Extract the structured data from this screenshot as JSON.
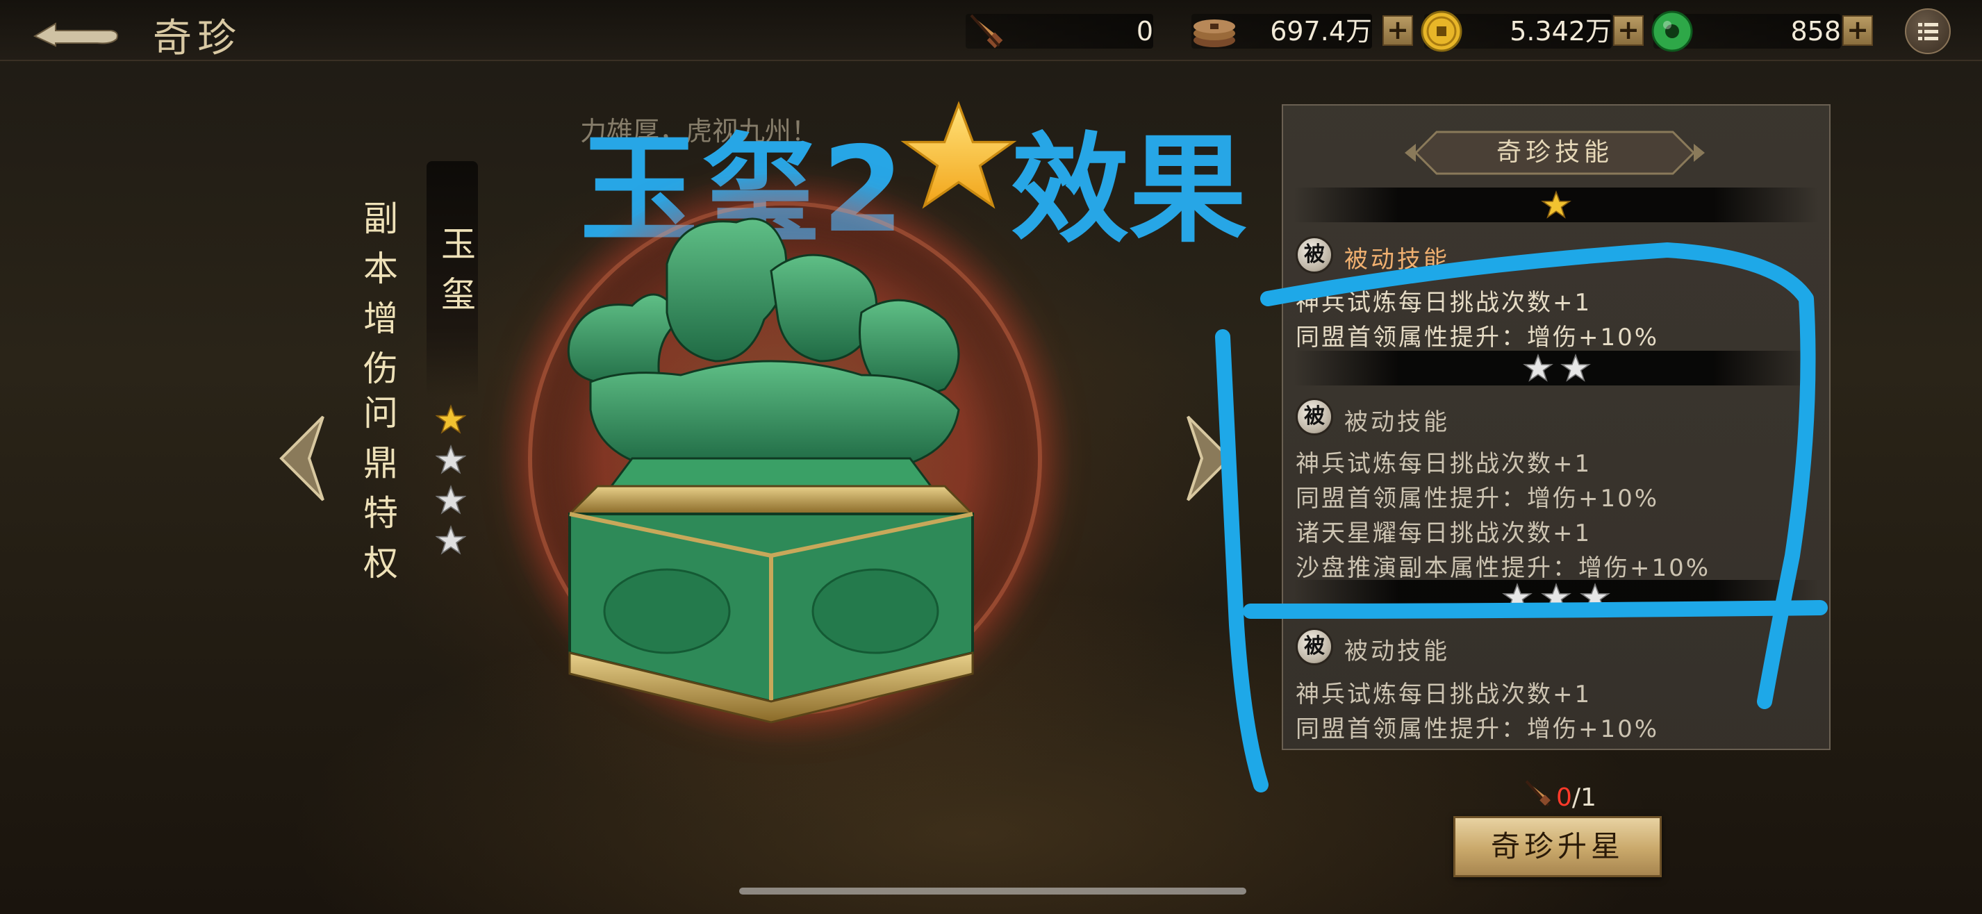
{
  "topbar": {
    "title": "奇珍",
    "resources": [
      {
        "icon": "token-icon",
        "value": "0"
      },
      {
        "icon": "coins-icon",
        "value": "697.4万"
      },
      {
        "icon": "gold-ingot-icon",
        "value": "5.342万"
      },
      {
        "icon": "jade-icon",
        "value": "858"
      }
    ],
    "plus_label": "+"
  },
  "annotation": {
    "headline_pre": "玉玺2",
    "headline_post": "效果",
    "flavor": "力雄厚，虎视九州！",
    "color": "#27a6e6"
  },
  "treasure": {
    "effect_line_1": "副本增伤",
    "effect_line_2": "问鼎特权",
    "name": "玉玺",
    "star_level": 1,
    "max_stars": 4
  },
  "panel": {
    "header": "奇珍技能",
    "skill_tiers": [
      {
        "stars": 1,
        "badge": "被",
        "title": "被动技能",
        "active": true,
        "lines": [
          "神兵试炼每日挑战次数+1",
          "同盟首领属性提升：增伤+10%"
        ]
      },
      {
        "stars": 2,
        "badge": "被",
        "title": "被动技能",
        "active": false,
        "lines": [
          "神兵试炼每日挑战次数+1",
          "同盟首领属性提升：增伤+10%",
          "诸天星耀每日挑战次数+1",
          "沙盘推演副本属性提升：增伤+10%"
        ]
      },
      {
        "stars": 3,
        "badge": "被",
        "title": "被动技能",
        "active": false,
        "lines": [
          "神兵试炼每日挑战次数+1",
          "同盟首领属性提升：增伤+10%"
        ]
      }
    ]
  },
  "upgrade": {
    "cost_have": "0",
    "cost_need": "/1",
    "button_label": "奇珍升星"
  },
  "colors": {
    "gold": "#f2c230",
    "silver": "#e6e6e6",
    "active_title": "#f0b070",
    "inactive_title": "#c9c0ae"
  }
}
